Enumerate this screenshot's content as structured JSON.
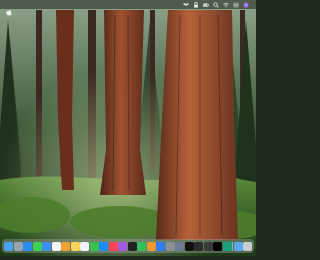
{
  "desktop": {
    "wallpaper": "forest-wallpaper"
  },
  "menubar": {
    "status_icons": [
      "dropbox-icon",
      "lock-icon",
      "battery-icon",
      "search-icon",
      "wifi-icon",
      "control-center-icon",
      "siri-icon"
    ],
    "clock": ""
  },
  "dock": {
    "apps": [
      {
        "name": "finder-icon",
        "color": "#4aa3f0"
      },
      {
        "name": "launchpad-icon",
        "color": "#9aa4b0"
      },
      {
        "name": "safari-icon",
        "color": "#2d8cf0"
      },
      {
        "name": "messages-icon",
        "color": "#3bd35a"
      },
      {
        "name": "mail-icon",
        "color": "#3a8ef6"
      },
      {
        "name": "calendar-icon",
        "color": "#f4f4f4"
      },
      {
        "name": "photos-icon",
        "color": "#f0a030"
      },
      {
        "name": "notes-icon",
        "color": "#f7d35a"
      },
      {
        "name": "reminders-icon",
        "color": "#f2f2f2"
      },
      {
        "name": "facetime-icon",
        "color": "#37c24e"
      },
      {
        "name": "app-store-icon",
        "color": "#1a8cff"
      },
      {
        "name": "music-icon",
        "color": "#f84359"
      },
      {
        "name": "podcasts-icon",
        "color": "#a35ae0"
      },
      {
        "name": "tv-icon",
        "color": "#222222"
      },
      {
        "name": "numbers-icon",
        "color": "#33c15d"
      },
      {
        "name": "pages-icon",
        "color": "#f29a2e"
      },
      {
        "name": "keynote-icon",
        "color": "#2f7df0"
      },
      {
        "name": "system-settings-icon",
        "color": "#8b8f96"
      },
      {
        "name": "preview-icon",
        "color": "#6b7c92"
      },
      {
        "name": "tiktok-icon",
        "color": "#111111"
      },
      {
        "name": "terminal-icon",
        "color": "#2b2b2b"
      },
      {
        "name": "camera-app-icon",
        "color": "#3a3a3a"
      },
      {
        "name": "music-note-icon",
        "color": "#000000"
      },
      {
        "name": "chatgpt-icon",
        "color": "#18a37e"
      },
      {
        "name": "downloads-folder-icon",
        "color": "#5aa8ee"
      },
      {
        "name": "trash-icon",
        "color": "#c9ccd1"
      }
    ]
  }
}
